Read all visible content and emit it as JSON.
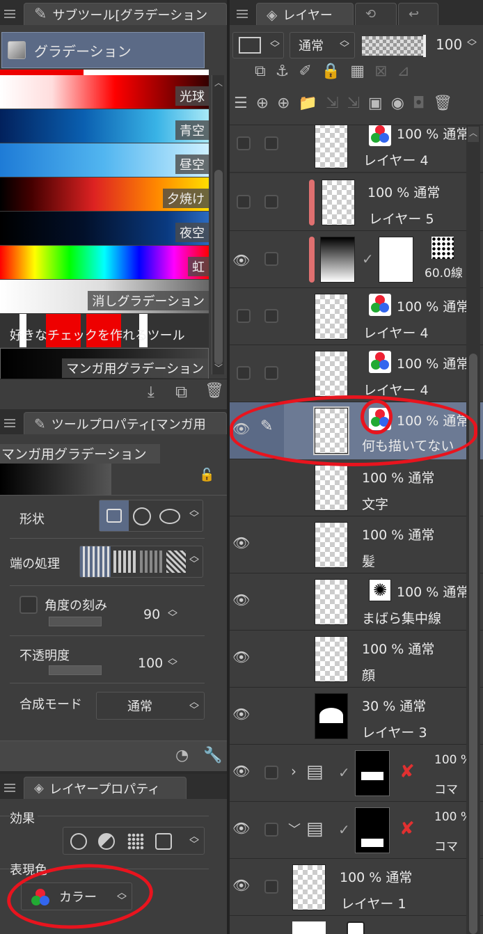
{
  "subtool": {
    "tab_title": "サブツール[グラデーション",
    "group_name": "グラデーション",
    "gradients": [
      {
        "label": "光球"
      },
      {
        "label": "青空"
      },
      {
        "label": "昼空"
      },
      {
        "label": "夕焼け"
      },
      {
        "label": "夜空"
      },
      {
        "label": "虹"
      },
      {
        "label": "消しグラデーション"
      },
      {
        "label": "好きなチェックを作れるツール"
      },
      {
        "label": "マンガ用グラデーション"
      }
    ]
  },
  "toolprop": {
    "tab_title": "ツールプロパティ[マンガ用",
    "preset_name": "マンガ用グラデーション",
    "shape_label": "形状",
    "edge_label": "端の処理",
    "angle_label": "角度の刻み",
    "angle_value": "90",
    "opacity_label": "不透明度",
    "opacity_value": "100",
    "blend_label": "合成モード",
    "blend_value": "通常"
  },
  "layerprop": {
    "tab_title": "レイヤープロパティ",
    "effect_label": "効果",
    "expr_label": "表現色",
    "color_value": "カラー"
  },
  "layers_panel": {
    "tab_title": "レイヤー",
    "blend_mode": "通常",
    "opacity": "100",
    "layers": [
      {
        "opacity_mode": "100 % 通常",
        "name": "レイヤー 4"
      },
      {
        "opacity_mode": "100 % 通常",
        "name": "レイヤー 5"
      },
      {
        "opacity_mode": "60.0線",
        "name": ""
      },
      {
        "opacity_mode": "100 % 通常",
        "name": "レイヤー 4"
      },
      {
        "opacity_mode": "100 % 通常",
        "name": "レイヤー 4"
      },
      {
        "opacity_mode": "100 % 通常",
        "name": "何も描いてない"
      },
      {
        "opacity_mode": "100 % 通常",
        "name": "文字"
      },
      {
        "opacity_mode": "100 % 通常",
        "name": "髪"
      },
      {
        "opacity_mode": "100 % 通常",
        "name": "まばら集中線"
      },
      {
        "opacity_mode": "100 % 通常",
        "name": "顔"
      },
      {
        "opacity_mode": "30 % 通常",
        "name": "レイヤー 3"
      },
      {
        "opacity_mode": "100 %",
        "name": "コマ"
      },
      {
        "opacity_mode": "100 %",
        "name": "コマ"
      },
      {
        "opacity_mode": "100 % 通常",
        "name": "レイヤー 1"
      }
    ]
  },
  "colors": {
    "accent": "#5b6a86",
    "panel": "#3d3d3d",
    "clip": "#e07070",
    "annotation": "#e8141e"
  }
}
